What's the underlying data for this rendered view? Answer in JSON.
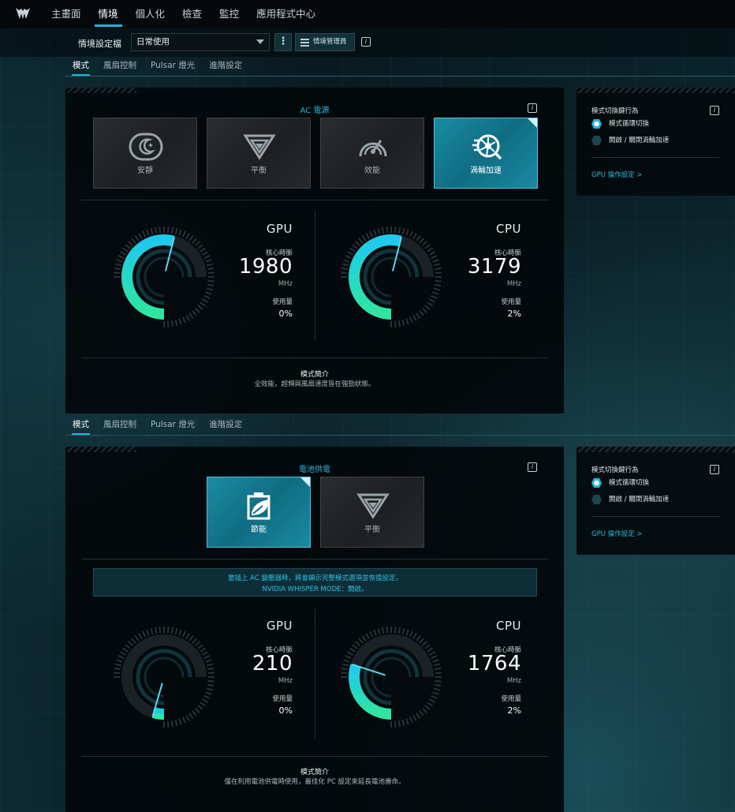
{
  "nav": {
    "items": [
      "主畫面",
      "情境",
      "個人化",
      "檢查",
      "監控",
      "應用程式中心"
    ],
    "active_index": 1
  },
  "profile": {
    "label": "情境設定檔",
    "selected": "日常使用",
    "manager_label": "情境管理員"
  },
  "subtabs": [
    "模式",
    "風扇控制",
    "Pulsar 燈光",
    "進階設定"
  ],
  "ac_section": {
    "title": "AC 電源",
    "modes": [
      {
        "label": "安靜",
        "icon": "quiet-mode-icon",
        "active": false
      },
      {
        "label": "平衡",
        "icon": "balanced-mode-icon",
        "active": false
      },
      {
        "label": "效能",
        "icon": "performance-mode-icon",
        "active": false
      },
      {
        "label": "渦輪加速",
        "icon": "turbo-mode-icon",
        "active": true
      }
    ],
    "gpu": {
      "title": "GPU",
      "clock_label": "核心時脈",
      "clock": "1980",
      "unit": "MHz",
      "usage_label": "使用量",
      "usage": "0%",
      "gauge_level": 0.72
    },
    "cpu": {
      "title": "CPU",
      "clock_label": "核心時脈",
      "clock": "3179",
      "unit": "MHz",
      "usage_label": "使用量",
      "usage": "2%",
      "gauge_level": 0.72
    },
    "desc_title": "模式簡介",
    "desc_text": "全效能，超頻與風扇速度皆在強勁狀態。"
  },
  "battery_section": {
    "title": "電池供電",
    "modes": [
      {
        "label": "節能",
        "icon": "eco-mode-icon",
        "active": true
      },
      {
        "label": "平衡",
        "icon": "balanced-mode-icon",
        "active": false
      }
    ],
    "notice_line1": "當插上 AC 變壓器時，將會顯示完整模式選項並恢復設定。",
    "notice_line2": "NVIDIA WHISPER MODE：開啟。",
    "gpu": {
      "title": "GPU",
      "clock_label": "核心時脈",
      "clock": "210",
      "unit": "MHz",
      "usage_label": "使用量",
      "usage": "0%",
      "gauge_level": 0.06
    },
    "cpu": {
      "title": "CPU",
      "clock_label": "核心時脈",
      "clock": "1764",
      "unit": "MHz",
      "usage_label": "使用量",
      "usage": "2%",
      "gauge_level": 0.4
    },
    "desc_title": "模式簡介",
    "desc_text": "僅在利用電池供電時使用，最佳化 PC 設定來延長電池壽命。"
  },
  "side": {
    "title": "模式切換鍵行為",
    "options": [
      "模式循環切換",
      "開啟 / 關閉渦輪加速"
    ],
    "selected_index": 0,
    "gpu_link": "GPU 操作設定 >"
  },
  "colors": {
    "accent": "#1fb6dc",
    "active_card": "#0f6d83",
    "gauge_start": "#1ec9ef",
    "gauge_end": "#2ee6a0"
  }
}
